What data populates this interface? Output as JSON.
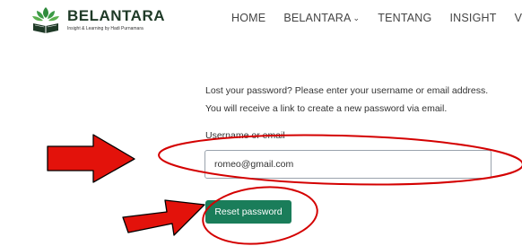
{
  "brand": {
    "name": "BELANTARA",
    "tagline": "Insight & Learning by Hadi Purnamara",
    "logo_icon": "open-book-leaves-icon",
    "color": "#1f3a27",
    "accent": "#2f8a3c"
  },
  "nav": {
    "items": [
      {
        "label": "HOME"
      },
      {
        "label": "BELANTARA",
        "has_dropdown": true,
        "chevron": "⌄"
      },
      {
        "label": "TENTANG"
      },
      {
        "label": "INSIGHT"
      },
      {
        "label": "VERIFIKA"
      }
    ]
  },
  "lost_password_form": {
    "instruction_line1": "Lost your password? Please enter your username or email address.",
    "instruction_line2": "You will receive a link to create a new password via email.",
    "username_label": "Username or email",
    "username_value": "romeo@gmail.com",
    "submit_label": "Reset password",
    "submit_color": "#1a7d5a"
  },
  "annotations": {
    "arrow_color": "#e3120b",
    "outline_color": "#d40000"
  }
}
